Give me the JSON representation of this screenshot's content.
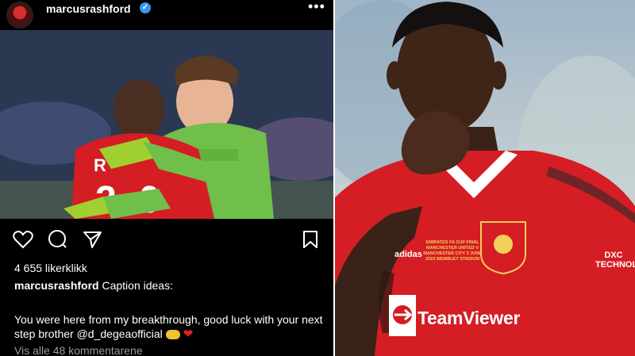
{
  "post": {
    "username": "marcusrashford",
    "verified": true,
    "more_icon": "more-horizontal-icon",
    "actions": [
      "heart-icon",
      "comment-icon",
      "share-icon",
      "bookmark-icon"
    ],
    "likes": "4 655 likerklikk",
    "caption_user": "marcusrashford",
    "caption_title": "Caption ideas:",
    "caption_body": "You were here from my breakthrough, good luck with your next step brother @d_degeaofficial",
    "view_comments": "Vis alle 48 kommentarene"
  },
  "photo": {
    "sponsor": "TeamViewer",
    "brand": "adidas",
    "sleeve_sponsor": "DXC TECHNOLOGY",
    "match_text": "EMIRATES FA CUP FINAL MANCHESTER UNITED V MANCHESTER CITY 3 JUNE 2023 WEMBLEY STADIUM"
  },
  "colors": {
    "kit_red": "#d51d24",
    "goalkeeper_green": "#6fbf4a",
    "verified_blue": "#3897f0",
    "heart_red": "#e02020"
  }
}
